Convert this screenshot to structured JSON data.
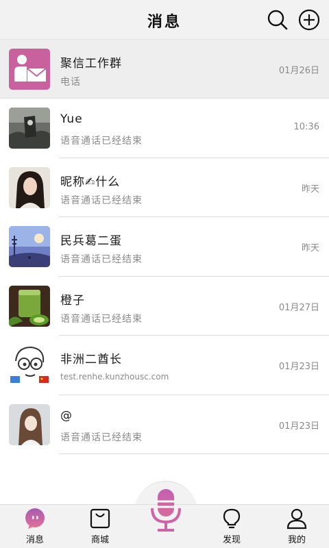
{
  "header": {
    "title": "消息"
  },
  "conversations": [
    {
      "name": "聚信工作群",
      "preview": "电话",
      "time": "01月26日"
    },
    {
      "name": "Yue",
      "preview": "语音通话已经结束",
      "time": "10:36"
    },
    {
      "name": "昵称✍什么",
      "preview": "语音通话已经结束",
      "time": "昨天"
    },
    {
      "name": "民兵葛二蛋",
      "preview": "语音通话已经结束",
      "time": "昨天"
    },
    {
      "name": "橙子",
      "preview": "语音通话已经结束",
      "time": "01月27日"
    },
    {
      "name": "非洲二酋长",
      "preview": "test.renhe.kunzhousc.com",
      "time": "01月23日"
    },
    {
      "name": "@",
      "preview": "语音通话已经结束",
      "time": "01月23日"
    }
  ],
  "tabs": {
    "messages": "消息",
    "mall": "商城",
    "discover": "发现",
    "mine": "我的"
  },
  "colors": {
    "accent": "#c9619f",
    "header_bg": "#f3f2f3",
    "text_secondary": "#8a8a8a"
  }
}
